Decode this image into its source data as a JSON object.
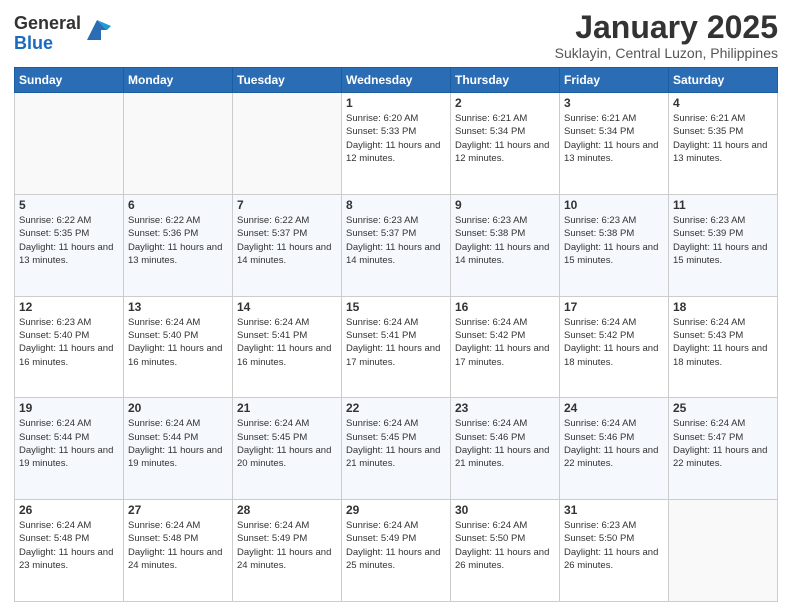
{
  "logo": {
    "general": "General",
    "blue": "Blue"
  },
  "title": {
    "month": "January 2025",
    "location": "Suklayin, Central Luzon, Philippines"
  },
  "weekdays": [
    "Sunday",
    "Monday",
    "Tuesday",
    "Wednesday",
    "Thursday",
    "Friday",
    "Saturday"
  ],
  "weeks": [
    [
      {
        "day": "",
        "sunrise": "",
        "sunset": "",
        "daylight": ""
      },
      {
        "day": "",
        "sunrise": "",
        "sunset": "",
        "daylight": ""
      },
      {
        "day": "",
        "sunrise": "",
        "sunset": "",
        "daylight": ""
      },
      {
        "day": "1",
        "sunrise": "Sunrise: 6:20 AM",
        "sunset": "Sunset: 5:33 PM",
        "daylight": "Daylight: 11 hours and 12 minutes."
      },
      {
        "day": "2",
        "sunrise": "Sunrise: 6:21 AM",
        "sunset": "Sunset: 5:34 PM",
        "daylight": "Daylight: 11 hours and 12 minutes."
      },
      {
        "day": "3",
        "sunrise": "Sunrise: 6:21 AM",
        "sunset": "Sunset: 5:34 PM",
        "daylight": "Daylight: 11 hours and 13 minutes."
      },
      {
        "day": "4",
        "sunrise": "Sunrise: 6:21 AM",
        "sunset": "Sunset: 5:35 PM",
        "daylight": "Daylight: 11 hours and 13 minutes."
      }
    ],
    [
      {
        "day": "5",
        "sunrise": "Sunrise: 6:22 AM",
        "sunset": "Sunset: 5:35 PM",
        "daylight": "Daylight: 11 hours and 13 minutes."
      },
      {
        "day": "6",
        "sunrise": "Sunrise: 6:22 AM",
        "sunset": "Sunset: 5:36 PM",
        "daylight": "Daylight: 11 hours and 13 minutes."
      },
      {
        "day": "7",
        "sunrise": "Sunrise: 6:22 AM",
        "sunset": "Sunset: 5:37 PM",
        "daylight": "Daylight: 11 hours and 14 minutes."
      },
      {
        "day": "8",
        "sunrise": "Sunrise: 6:23 AM",
        "sunset": "Sunset: 5:37 PM",
        "daylight": "Daylight: 11 hours and 14 minutes."
      },
      {
        "day": "9",
        "sunrise": "Sunrise: 6:23 AM",
        "sunset": "Sunset: 5:38 PM",
        "daylight": "Daylight: 11 hours and 14 minutes."
      },
      {
        "day": "10",
        "sunrise": "Sunrise: 6:23 AM",
        "sunset": "Sunset: 5:38 PM",
        "daylight": "Daylight: 11 hours and 15 minutes."
      },
      {
        "day": "11",
        "sunrise": "Sunrise: 6:23 AM",
        "sunset": "Sunset: 5:39 PM",
        "daylight": "Daylight: 11 hours and 15 minutes."
      }
    ],
    [
      {
        "day": "12",
        "sunrise": "Sunrise: 6:23 AM",
        "sunset": "Sunset: 5:40 PM",
        "daylight": "Daylight: 11 hours and 16 minutes."
      },
      {
        "day": "13",
        "sunrise": "Sunrise: 6:24 AM",
        "sunset": "Sunset: 5:40 PM",
        "daylight": "Daylight: 11 hours and 16 minutes."
      },
      {
        "day": "14",
        "sunrise": "Sunrise: 6:24 AM",
        "sunset": "Sunset: 5:41 PM",
        "daylight": "Daylight: 11 hours and 16 minutes."
      },
      {
        "day": "15",
        "sunrise": "Sunrise: 6:24 AM",
        "sunset": "Sunset: 5:41 PM",
        "daylight": "Daylight: 11 hours and 17 minutes."
      },
      {
        "day": "16",
        "sunrise": "Sunrise: 6:24 AM",
        "sunset": "Sunset: 5:42 PM",
        "daylight": "Daylight: 11 hours and 17 minutes."
      },
      {
        "day": "17",
        "sunrise": "Sunrise: 6:24 AM",
        "sunset": "Sunset: 5:42 PM",
        "daylight": "Daylight: 11 hours and 18 minutes."
      },
      {
        "day": "18",
        "sunrise": "Sunrise: 6:24 AM",
        "sunset": "Sunset: 5:43 PM",
        "daylight": "Daylight: 11 hours and 18 minutes."
      }
    ],
    [
      {
        "day": "19",
        "sunrise": "Sunrise: 6:24 AM",
        "sunset": "Sunset: 5:44 PM",
        "daylight": "Daylight: 11 hours and 19 minutes."
      },
      {
        "day": "20",
        "sunrise": "Sunrise: 6:24 AM",
        "sunset": "Sunset: 5:44 PM",
        "daylight": "Daylight: 11 hours and 19 minutes."
      },
      {
        "day": "21",
        "sunrise": "Sunrise: 6:24 AM",
        "sunset": "Sunset: 5:45 PM",
        "daylight": "Daylight: 11 hours and 20 minutes."
      },
      {
        "day": "22",
        "sunrise": "Sunrise: 6:24 AM",
        "sunset": "Sunset: 5:45 PM",
        "daylight": "Daylight: 11 hours and 21 minutes."
      },
      {
        "day": "23",
        "sunrise": "Sunrise: 6:24 AM",
        "sunset": "Sunset: 5:46 PM",
        "daylight": "Daylight: 11 hours and 21 minutes."
      },
      {
        "day": "24",
        "sunrise": "Sunrise: 6:24 AM",
        "sunset": "Sunset: 5:46 PM",
        "daylight": "Daylight: 11 hours and 22 minutes."
      },
      {
        "day": "25",
        "sunrise": "Sunrise: 6:24 AM",
        "sunset": "Sunset: 5:47 PM",
        "daylight": "Daylight: 11 hours and 22 minutes."
      }
    ],
    [
      {
        "day": "26",
        "sunrise": "Sunrise: 6:24 AM",
        "sunset": "Sunset: 5:48 PM",
        "daylight": "Daylight: 11 hours and 23 minutes."
      },
      {
        "day": "27",
        "sunrise": "Sunrise: 6:24 AM",
        "sunset": "Sunset: 5:48 PM",
        "daylight": "Daylight: 11 hours and 24 minutes."
      },
      {
        "day": "28",
        "sunrise": "Sunrise: 6:24 AM",
        "sunset": "Sunset: 5:49 PM",
        "daylight": "Daylight: 11 hours and 24 minutes."
      },
      {
        "day": "29",
        "sunrise": "Sunrise: 6:24 AM",
        "sunset": "Sunset: 5:49 PM",
        "daylight": "Daylight: 11 hours and 25 minutes."
      },
      {
        "day": "30",
        "sunrise": "Sunrise: 6:24 AM",
        "sunset": "Sunset: 5:50 PM",
        "daylight": "Daylight: 11 hours and 26 minutes."
      },
      {
        "day": "31",
        "sunrise": "Sunrise: 6:23 AM",
        "sunset": "Sunset: 5:50 PM",
        "daylight": "Daylight: 11 hours and 26 minutes."
      },
      {
        "day": "",
        "sunrise": "",
        "sunset": "",
        "daylight": ""
      }
    ]
  ]
}
